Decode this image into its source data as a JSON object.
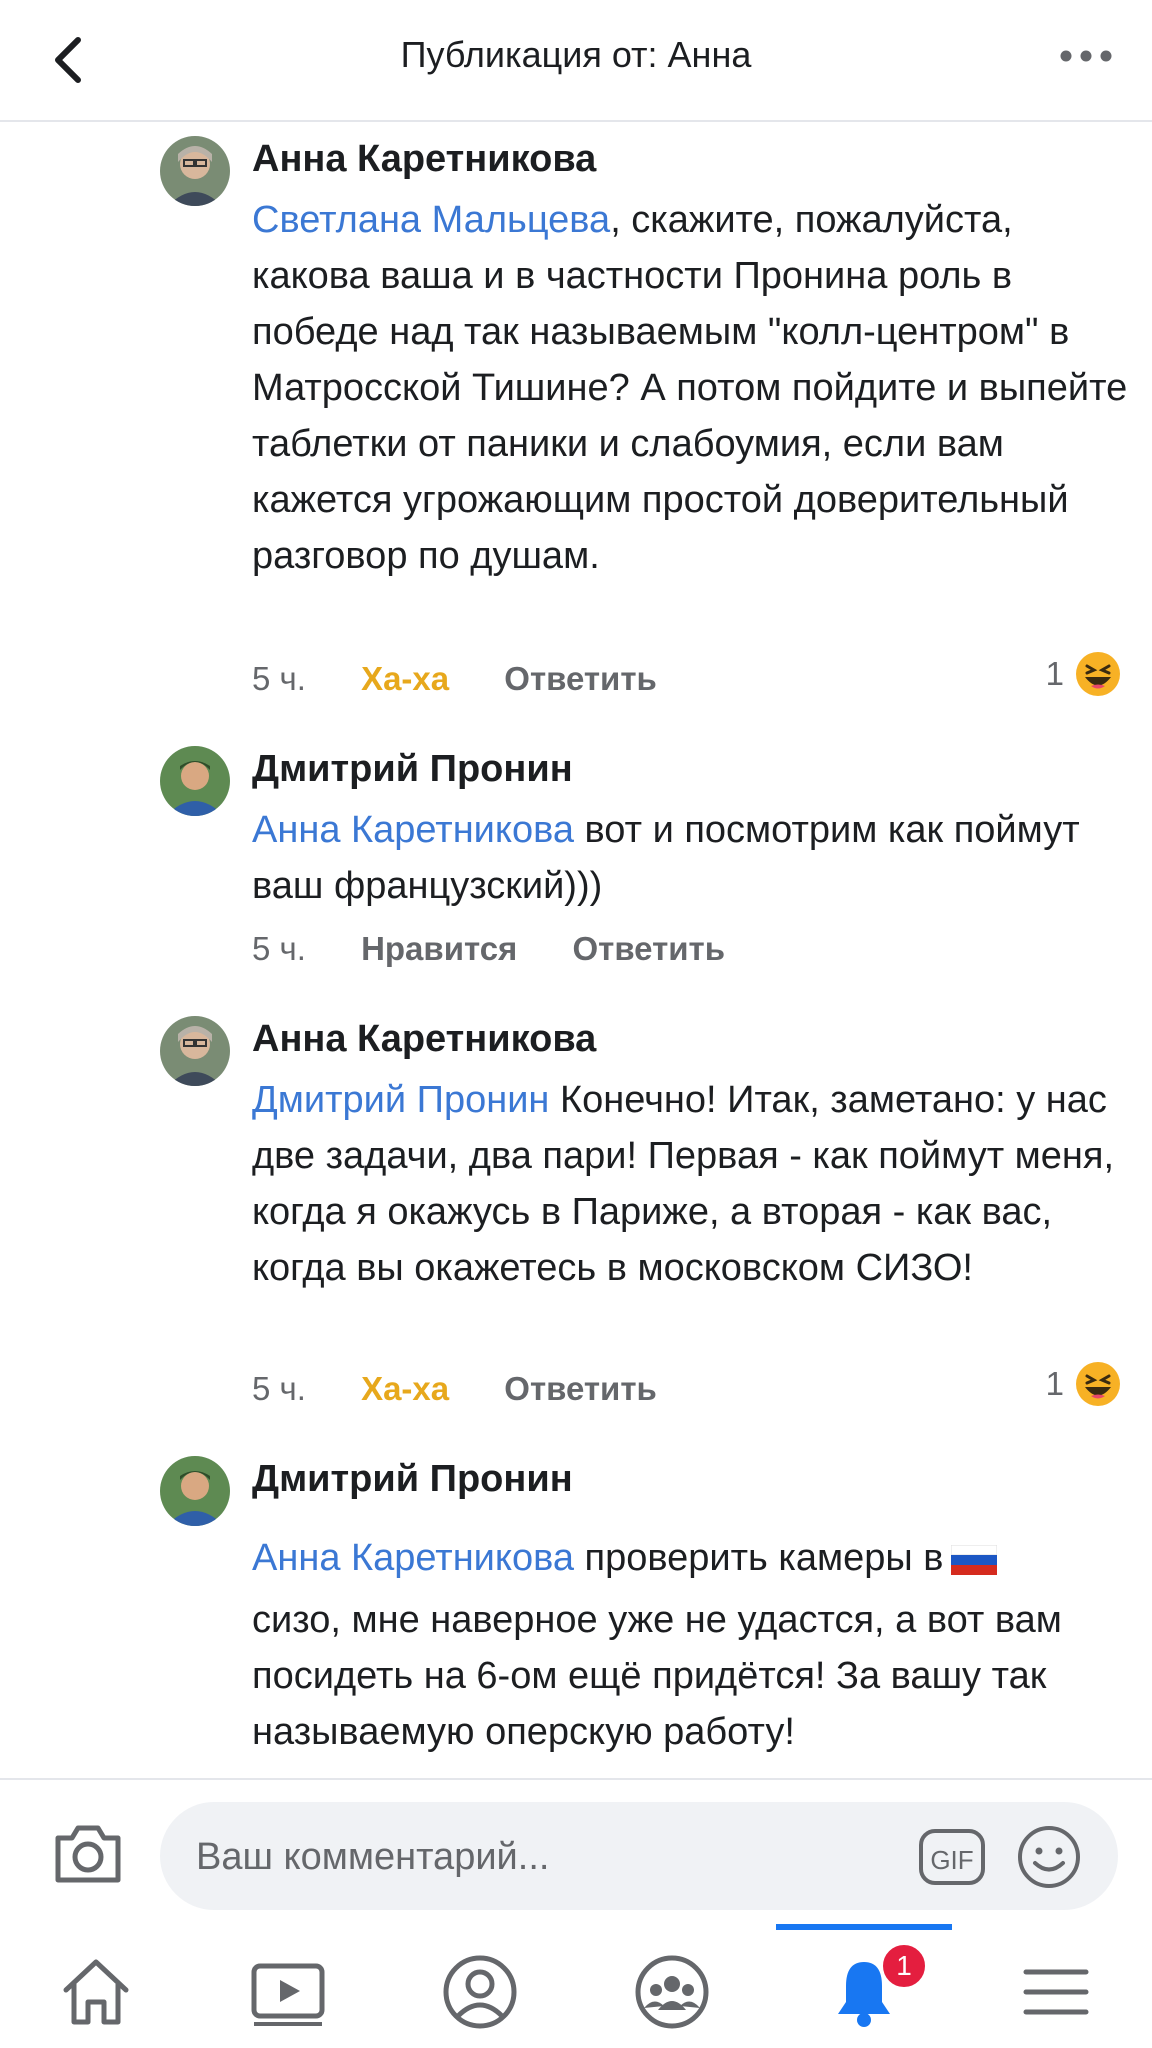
{
  "header": {
    "title": "Публикация от: Анна"
  },
  "comments": [
    {
      "author": "Анна Каретникова",
      "mention": "Светлана Мальцева",
      "text": ", скажите, пожалуйста, какова ваша и в частности Пронина роль в победе над так называемым \"колл-центром\" в Матросской Тишине? А потом пойдите и выпейте таблетки от паники и слабоумия, если вам кажется угрожающим простой доверительный разговор по душам.",
      "time": "5 ч.",
      "reaction": "Ха-ха",
      "reply": "Ответить",
      "reaction_count": "1"
    },
    {
      "author": "Дмитрий Пронин",
      "mention": "Анна Каретникова",
      "text": " вот и посмотрим как поймут ваш французский)))",
      "time": "5 ч.",
      "reaction": "Нравится",
      "reply": "Ответить"
    },
    {
      "author": "Анна Каретникова",
      "mention": "Дмитрий Пронин",
      "text": " Конечно! Итак, заметано: у нас две задачи, два пари! Первая - как поймут меня, когда я окажусь в Париже, а вторая - как вас, когда вы окажетесь в московском СИЗО!",
      "time": "5 ч.",
      "reaction": "Ха-ха",
      "reply": "Ответить",
      "reaction_count": "1"
    },
    {
      "author": "Дмитрий Пронин",
      "mention": "Анна Каретникова",
      "text_line1": " проверить камеры в",
      "text": "сизо, мне наверное уже не удастся, а вот вам посидеть на 6-ом ещё придётся! За вашу так называемую оперскую работу!"
    }
  ],
  "composer": {
    "placeholder": "Ваш комментарий...",
    "gif_label": "GIF"
  },
  "nav": {
    "active": "notifications",
    "notification_badge": "1"
  },
  "colors": {
    "mention": "#3b78d4",
    "haha": "#e7a81c",
    "active_nav": "#1877f2",
    "badge": "#e41e3f"
  }
}
